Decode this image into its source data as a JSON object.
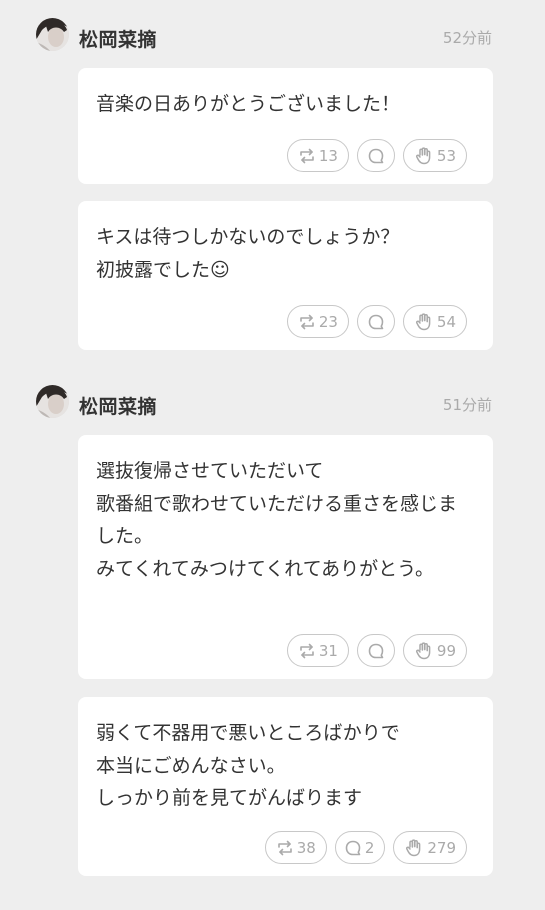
{
  "groups": [
    {
      "author": "松岡菜摘",
      "time": "52分前",
      "posts": [
        {
          "text": "音楽の日ありがとうございました！",
          "repost": "13",
          "reply": "",
          "clap": "53"
        },
        {
          "text": "キスは待つしかないのでしょうか？\n初披露でした☺",
          "repost": "23",
          "reply": "",
          "clap": "54"
        }
      ]
    },
    {
      "author": "松岡菜摘",
      "time": "51分前",
      "posts": [
        {
          "text": "選抜復帰させていただいて\n歌番組で歌わせていただける重さを感じました。\nみてくれてみつけてくれてありがとう。",
          "repost": "31",
          "reply": "",
          "clap": "99"
        },
        {
          "text": "弱くて不器用で悪いところばかりで\n本当にごめんなさい。\nしっかり前を見てがんばります",
          "repost": "38",
          "reply": "2",
          "clap": "279"
        }
      ]
    }
  ],
  "icons": {
    "repost": "repost-icon",
    "reply": "reply-icon",
    "clap": "clap-icon"
  }
}
